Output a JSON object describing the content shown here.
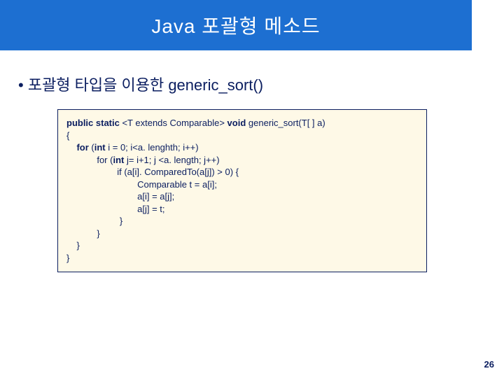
{
  "title": "Java 포괄형 메소드",
  "bullet": {
    "marker": "•",
    "text": "포괄형 타입을 이용한 generic_sort()"
  },
  "code": {
    "l1a": "public static ",
    "l1b": "<T extends Comparable>",
    "l1c": " void",
    "l1d": " generic_sort(T[ ] a)",
    "l2": "{",
    "l3a": "    for",
    "l3b": " (",
    "l3c": "int",
    "l3d": " i = 0; i<a. lenghth; i++)",
    "l4a": "            for (",
    "l4b": "int",
    "l4c": " j= i+1; j <a. length; j++)",
    "l5": "                    if (a[i]. ComparedTo(a[j]) > 0) {",
    "l6": "                            Comparable t = a[i];",
    "l7": "                            a[i] = a[j];",
    "l8": "                            a[j] = t;",
    "l9": "                     }",
    "l10": "            }",
    "l11": "    }",
    "l12": "}"
  },
  "pageNumber": "26"
}
